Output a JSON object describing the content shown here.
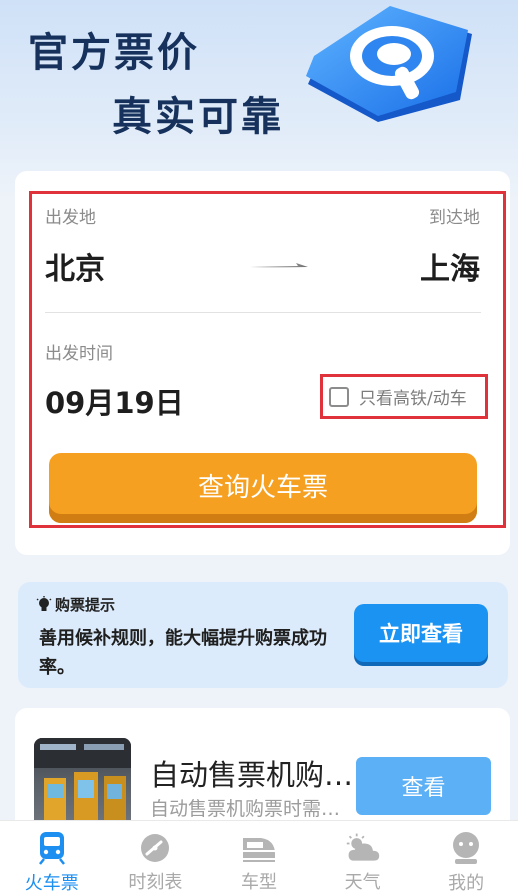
{
  "banner": {
    "line1": "官方票价",
    "line2": "真实可靠",
    "logo_icon": "search-magnifier-logo-icon"
  },
  "search": {
    "from_label": "出发地",
    "to_label": "到达地",
    "from_city": "北京",
    "to_city": "上海",
    "date_label": "出发时间",
    "date_value": "09月19日",
    "high_speed_only_label": "只看高铁/动车",
    "high_speed_only_checked": false,
    "query_button": "查询火车票"
  },
  "tips": {
    "title": "购票提示",
    "title_icon": "lightbulb-icon",
    "body": "善用候补规则，能大幅提升购票成功率。",
    "button": "立即查看"
  },
  "promo": {
    "title": "自动售票机购票攻略",
    "subtitle": "自动售票机购票时需要注意",
    "button": "查看"
  },
  "tabs": [
    {
      "label": "火车票",
      "icon": "train-icon",
      "active": true
    },
    {
      "label": "时刻表",
      "icon": "clock-icon",
      "active": false
    },
    {
      "label": "车型",
      "icon": "bullet-train-icon",
      "active": false
    },
    {
      "label": "天气",
      "icon": "weather-icon",
      "active": false
    },
    {
      "label": "我的",
      "icon": "profile-icon",
      "active": false
    }
  ],
  "colors": {
    "accent_blue": "#1d8ff0",
    "query_orange": "#f6a021",
    "highlight_red": "#e0323a",
    "title_navy": "#16325c"
  }
}
